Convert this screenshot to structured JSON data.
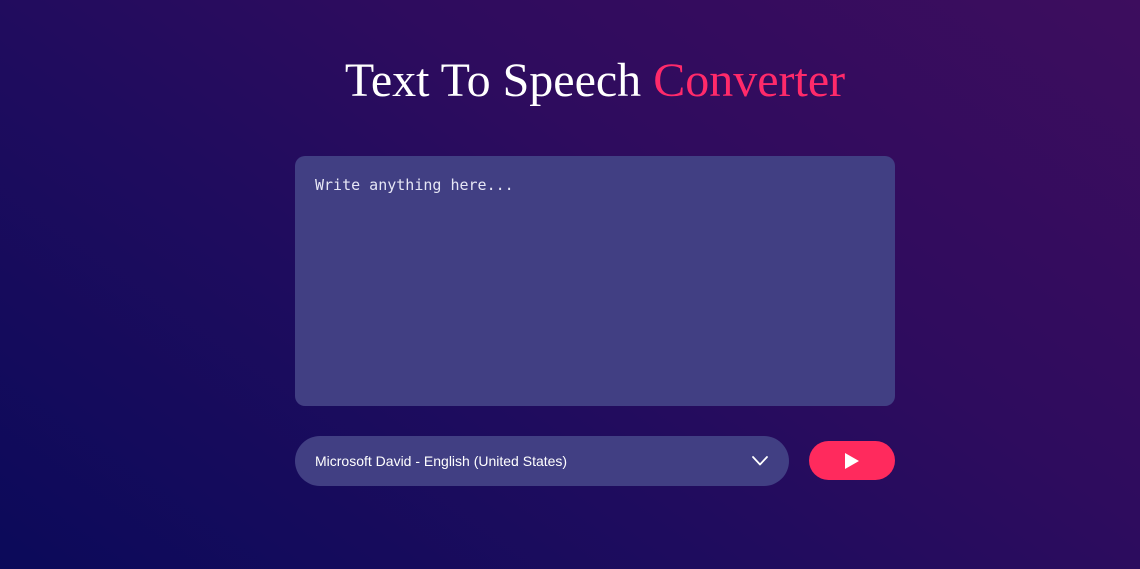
{
  "header": {
    "title_main": "Text To Speech",
    "title_accent": "Converter"
  },
  "editor": {
    "placeholder": "Write anything here...",
    "value": ""
  },
  "voice_select": {
    "selected": "Microsoft David - English (United States)",
    "icon": "chevron-down-icon"
  },
  "play_button": {
    "icon": "play-icon"
  },
  "colors": {
    "accent": "#ff2a6a",
    "button": "#ff2a5d",
    "panel": "#413f83",
    "background_start": "#0b0a5a",
    "background_end": "#3d0d5e"
  }
}
